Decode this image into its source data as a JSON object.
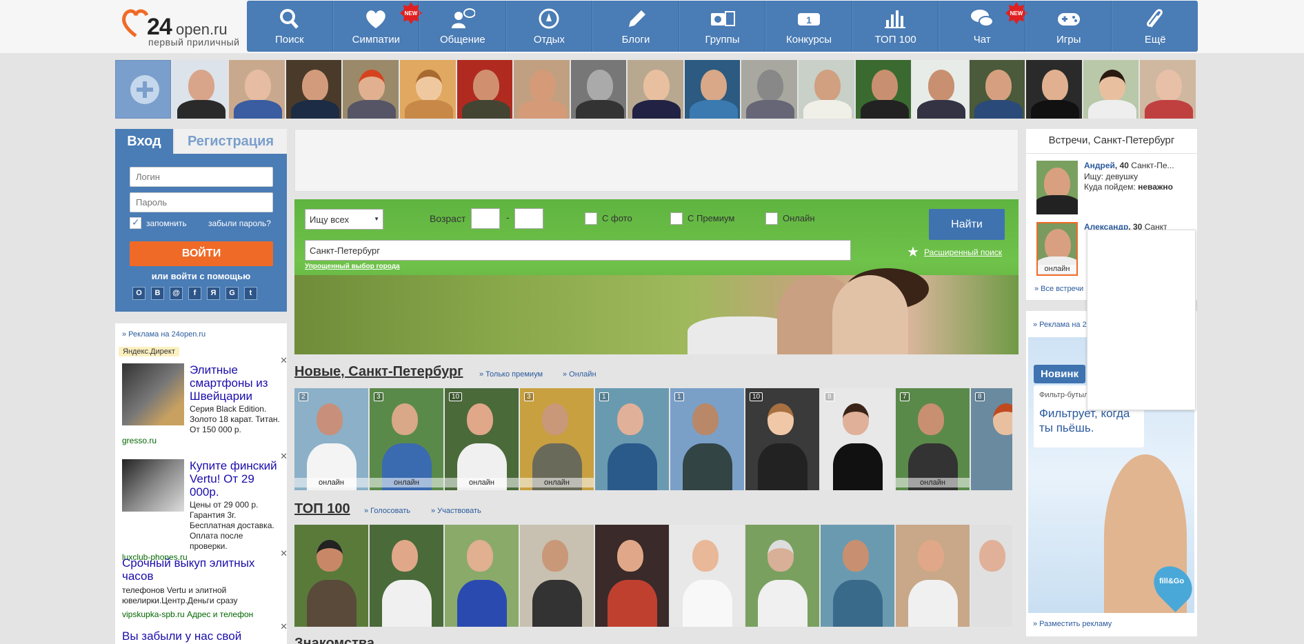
{
  "logo": {
    "num": "24",
    "domain": "open.ru",
    "tagline": "первый приличный"
  },
  "nav": [
    {
      "label": "Поиск",
      "icon": "search-icon",
      "new": false
    },
    {
      "label": "Симпатии",
      "icon": "heart-icon",
      "new": true
    },
    {
      "label": "Общение",
      "icon": "chat-users-icon",
      "new": false
    },
    {
      "label": "Отдых",
      "icon": "compass-icon",
      "new": false
    },
    {
      "label": "Блоги",
      "icon": "pencil-icon",
      "new": false
    },
    {
      "label": "Группы",
      "icon": "camera-film-icon",
      "new": false
    },
    {
      "label": "Конкурсы",
      "icon": "award-icon",
      "new": false
    },
    {
      "label": "ТОП 100",
      "icon": "bar-chart-icon",
      "new": false
    },
    {
      "label": "Чат",
      "icon": "speech-bubbles-icon",
      "new": true
    },
    {
      "label": "Игры",
      "icon": "gamepad-icon",
      "new": false
    },
    {
      "label": "Ещё",
      "icon": "paperclip-icon",
      "new": false
    }
  ],
  "new_badge": "NEW",
  "konkursy_badge": "1",
  "login": {
    "tab_login": "Вход",
    "tab_register": "Регистрация",
    "login_placeholder": "Логин",
    "password_placeholder": "Пароль",
    "remember": "запомнить",
    "forgot": "забыли пароль?",
    "button": "ВОЙТИ",
    "via": "или войти с помощью",
    "socials": [
      "О",
      "В",
      "@",
      "f",
      "Я",
      "G",
      "t"
    ]
  },
  "adsL": {
    "head": "» Реклама на 24open.ru",
    "yandex": "Яндекс.Директ",
    "items": [
      {
        "title": "Элитные смартфоны из Швейцарии",
        "desc": "Серия Black Edition. Золото 18 карат. Титан. От 150 000 р.",
        "url": "gresso.ru"
      },
      {
        "title": "Купите финский Vertu! От 29 000р.",
        "desc": "Цены от 29 000 р. Гарантия 3г. Бесплатная доставка. Оплата после проверки.",
        "url": "luxclub-phones.ru"
      },
      {
        "title": "Срочный выкуп элитных часов",
        "desc": "телефонов Vertu и элитной ювелирки.Центр.Деньги сразу",
        "url": "vipskupka-spb.ru   Адрес и телефон"
      },
      {
        "title": "Вы забыли у нас свой",
        "desc": "",
        "url": ""
      }
    ]
  },
  "search": {
    "select": "Ищу всех",
    "age": "Возраст",
    "dash": "-",
    "with_photo": "С фото",
    "with_premium": "С Премиум",
    "online": "Онлайн",
    "find": "Найти",
    "city": "Санкт-Петербург",
    "simple_city": "Упрощенный выбор города",
    "advanced": "Расширенный поиск"
  },
  "new_section": {
    "title": "Новые, Санкт-Петербург",
    "link1": "» Только премиум",
    "link2": "» Онлайн",
    "counts": [
      "2",
      "3",
      "10",
      "3",
      "1",
      "1",
      "10",
      "8",
      "7",
      "8"
    ],
    "online": [
      true,
      true,
      true,
      true,
      false,
      false,
      false,
      false,
      true,
      false
    ],
    "online_label": "онлайн"
  },
  "top_section": {
    "title": "ТОП 100",
    "link1": "» Голосовать",
    "link2": "» Участвовать"
  },
  "bottom_cut": "Знакомства",
  "meet": {
    "title": "Встречи, Санкт-Петербург",
    "p1": {
      "name": "Андрей",
      "age": ", 40",
      "city": " Санкт-Пе...",
      "seek_label": "Ищу: ",
      "seek": "девушку",
      "where_label": "Куда пойдем: ",
      "where": "неважно"
    },
    "p2": {
      "name": "Александр",
      "age": ", 30",
      "city": " Санкт-...",
      "online": "онлайн"
    },
    "all": "» Все встречи"
  },
  "adsR": {
    "head": "» Реклама на 2",
    "badge": "Новинк",
    "small": "Фильтр-бутыл",
    "big": "Фильтрует, когда ты пьёшь.",
    "brand": "fill&Go",
    "place": "» Разместить рекламу"
  },
  "colors": {
    "nav_blue": "#4a7cb5",
    "login_orange": "#f06a27",
    "link_blue": "#2a5a9e"
  }
}
